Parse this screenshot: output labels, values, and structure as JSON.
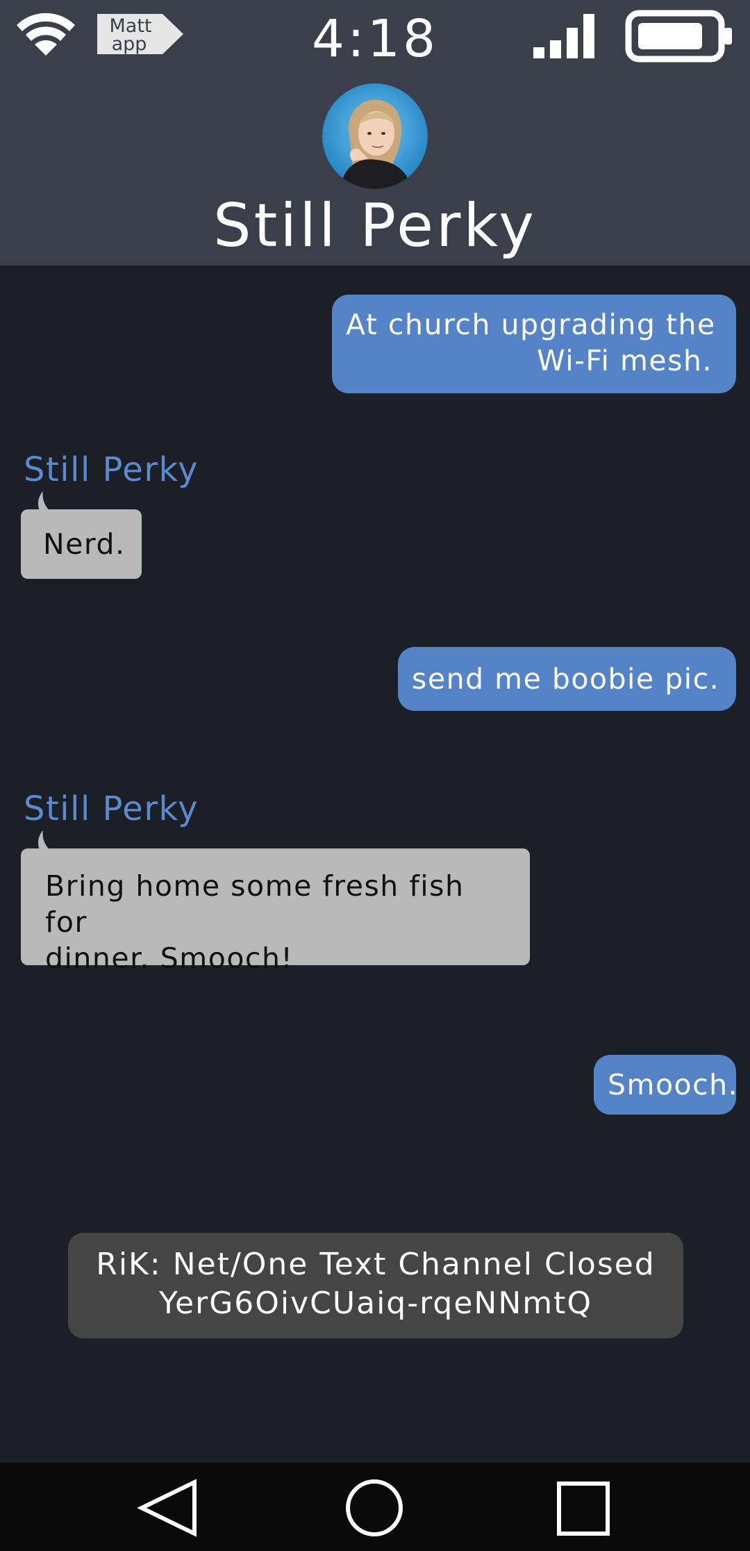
{
  "status_bar": {
    "time": "4:18",
    "app_badge_line1": "Matt",
    "app_badge_line2": "app"
  },
  "header": {
    "contact_name": "Still Perky"
  },
  "messages": [
    {
      "direction": "outgoing",
      "lines": [
        "At church upgrading the",
        "Wi-Fi mesh."
      ]
    },
    {
      "direction": "incoming",
      "sender": "Still Perky",
      "lines": [
        "Nerd."
      ]
    },
    {
      "direction": "outgoing",
      "lines": [
        "send me boobie pic."
      ]
    },
    {
      "direction": "incoming",
      "sender": "Still Perky",
      "lines": [
        "Bring home some fresh fish for",
        "dinner. Smooch!"
      ]
    },
    {
      "direction": "outgoing",
      "lines": [
        "Smooch."
      ]
    }
  ],
  "system_notice": {
    "line1": "RiK: Net/One Text Channel Closed",
    "line2": "YerG6OivCUaiq-rqeNNmtQ"
  },
  "nav": {
    "back_icon": "triangle-back-icon",
    "home_icon": "circle-home-icon",
    "recents_icon": "square-recents-icon"
  },
  "colors": {
    "header_bg": "#3a3f49",
    "chat_bg": "#1d1f27",
    "outgoing_bubble": "#5583c8",
    "incoming_bubble": "#b9b9b9",
    "sender_label": "#5a8ad0",
    "notice_bg": "#454545",
    "nav_bg": "#0a0a0a"
  }
}
